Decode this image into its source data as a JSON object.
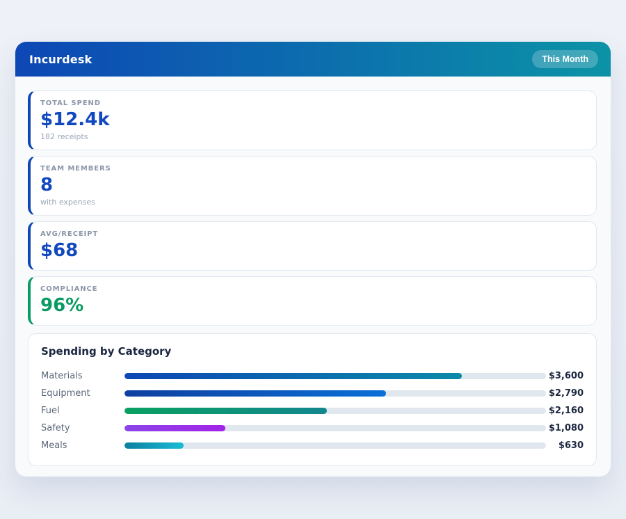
{
  "header": {
    "title": "Incurdesk",
    "badge": "This Month",
    "gradient_from": "#0d47b5",
    "gradient_to": "#0c93a6"
  },
  "stats": [
    {
      "label": "TOTAL SPEND",
      "value": "$12.4k",
      "sub": "182 receipts",
      "accent": "#0d47b5",
      "value_color": "#1148c0"
    },
    {
      "label": "TEAM MEMBERS",
      "value": "8",
      "sub": "with expenses",
      "accent": "#0d47b5",
      "value_color": "#1148c0"
    },
    {
      "label": "AVG/RECEIPT",
      "value": "$68",
      "sub": "",
      "accent": "#0d47b5",
      "value_color": "#1148c0"
    },
    {
      "label": "COMPLIANCE",
      "value": "96%",
      "sub": "",
      "accent": "#0a9b62",
      "value_color": "#0a9b62"
    }
  ],
  "chart": {
    "title": "Spending by Category",
    "track_color": "#e1e7ef",
    "rows": [
      {
        "label": "Materials",
        "value_label": "$3,600",
        "pct": 80,
        "color_from": "#0d47b5",
        "color_to": "#0c8aa8"
      },
      {
        "label": "Equipment",
        "value_label": "$2,790",
        "pct": 62,
        "color_from": "#0e3fa0",
        "color_to": "#0a6fd6"
      },
      {
        "label": "Fuel",
        "value_label": "$2,160",
        "pct": 48,
        "color_from": "#0aa061",
        "color_to": "#12878f"
      },
      {
        "label": "Safety",
        "value_label": "$1,080",
        "pct": 24,
        "color_from": "#8b45e8",
        "color_to": "#a224e8"
      },
      {
        "label": "Meals",
        "value_label": "$630",
        "pct": 14,
        "color_from": "#0e7fa0",
        "color_to": "#18bcd4"
      }
    ]
  },
  "chart_data": {
    "type": "bar",
    "orientation": "horizontal",
    "title": "Spending by Category",
    "categories": [
      "Materials",
      "Equipment",
      "Fuel",
      "Safety",
      "Meals"
    ],
    "values": [
      3600,
      2790,
      2160,
      1080,
      630
    ],
    "value_labels": [
      "$3,600",
      "$2,790",
      "$2,160",
      "$1,080",
      "$630"
    ],
    "xlim": [
      0,
      4500
    ],
    "grid": false,
    "legend": false
  }
}
